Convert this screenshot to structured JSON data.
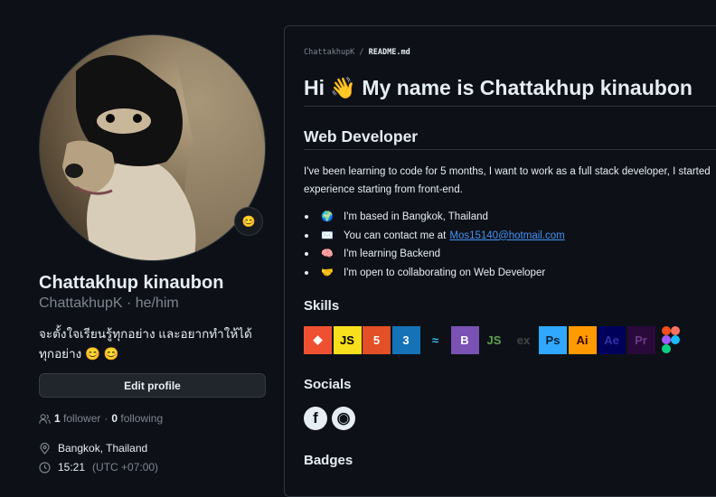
{
  "profile": {
    "status_emoji": "😊",
    "full_name": "Chattakhup kinaubon",
    "username_line": "ChattakhupK · he/him",
    "bio": "จะตั้งใจเรียนรู้ทุกอย่าง และอยากทำให้ได้ทุกอย่าง 😊 😊",
    "edit_profile_label": "Edit profile",
    "followers_count": "1",
    "followers_label": "follower",
    "separator": "·",
    "following_count": "0",
    "following_label": "following",
    "location": "Bangkok, Thailand",
    "local_time": "15:21",
    "timezone": "(UTC +07:00)"
  },
  "readme": {
    "breadcrumb_user": "ChattakhupK",
    "breadcrumb_sep": "/",
    "breadcrumb_file": "README.md",
    "title": "Hi 👋 My name is Chattakhup kinaubon",
    "subtitle": "Web Developer",
    "intro_line1": "I've been learning to code for 5 months, I want to work as a full stack developer, I started",
    "intro_line2": "experience starting from front-end.",
    "facts": [
      {
        "emoji": "🌍",
        "text": "I'm based in Bangkok, Thailand"
      },
      {
        "emoji": "✉️",
        "text": "You can contact me at",
        "link": "Mos15140@hotmail.com"
      },
      {
        "emoji": "🧠",
        "text": "I'm learning Backend"
      },
      {
        "emoji": "🤝",
        "text": "I'm open to collaborating on Web Developer"
      }
    ],
    "skills_heading": "Skills",
    "skills": [
      {
        "name": "git-icon",
        "label": "◆",
        "bg": "#f05032",
        "fg": "#ffffff"
      },
      {
        "name": "javascript-icon",
        "label": "JS",
        "bg": "#f7df1e",
        "fg": "#000000"
      },
      {
        "name": "html5-icon",
        "label": "5",
        "bg": "#e34f26",
        "fg": "#ffffff"
      },
      {
        "name": "css3-icon",
        "label": "3",
        "bg": "#1572b6",
        "fg": "#ffffff"
      },
      {
        "name": "tailwind-icon",
        "label": "≈",
        "bg": "#0d1117",
        "fg": "#38bdf8"
      },
      {
        "name": "bootstrap-icon",
        "label": "B",
        "bg": "#7952b3",
        "fg": "#ffffff"
      },
      {
        "name": "nodejs-icon",
        "label": "JS",
        "bg": "#0d1117",
        "fg": "#5fa04e"
      },
      {
        "name": "express-icon",
        "label": "ex",
        "bg": "#0d1117",
        "fg": "#444444"
      },
      {
        "name": "photoshop-icon",
        "label": "Ps",
        "bg": "#31a8ff",
        "fg": "#001e36"
      },
      {
        "name": "illustrator-icon",
        "label": "Ai",
        "bg": "#ff9a00",
        "fg": "#330000"
      },
      {
        "name": "aftereffects-icon",
        "label": "Ae",
        "bg": "#00005b",
        "fg": "#3333aa"
      },
      {
        "name": "premiere-icon",
        "label": "Pr",
        "bg": "#2a0a3a",
        "fg": "#6a3a8a"
      },
      {
        "name": "figma-icon",
        "label": "",
        "bg": "#0d1117",
        "fg": "#f24e1e"
      }
    ],
    "socials_heading": "Socials",
    "socials": [
      {
        "name": "facebook-icon",
        "label": "f"
      },
      {
        "name": "github-icon",
        "label": "◉"
      }
    ],
    "badges_heading": "Badges"
  },
  "colors": {
    "background": "#0d1117",
    "text": "#e6edf3",
    "muted": "#7d8590",
    "link": "#4493f8",
    "border": "#30363d"
  }
}
